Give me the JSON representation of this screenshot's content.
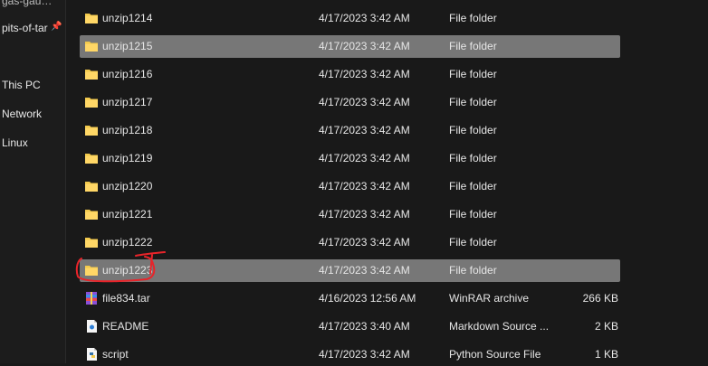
{
  "sidebar": {
    "items": [
      {
        "label": "pits-of-tar"
      },
      {
        "label": "This PC"
      },
      {
        "label": "Network"
      },
      {
        "label": "Linux"
      }
    ]
  },
  "files": [
    {
      "name": "unzip1214",
      "date": "4/17/2023 3:42 AM",
      "type": "File folder",
      "size": "",
      "icon": "folder-icon",
      "selected": false
    },
    {
      "name": "unzip1215",
      "date": "4/17/2023 3:42 AM",
      "type": "File folder",
      "size": "",
      "icon": "folder-icon",
      "selected": true
    },
    {
      "name": "unzip1216",
      "date": "4/17/2023 3:42 AM",
      "type": "File folder",
      "size": "",
      "icon": "folder-icon",
      "selected": false
    },
    {
      "name": "unzip1217",
      "date": "4/17/2023 3:42 AM",
      "type": "File folder",
      "size": "",
      "icon": "folder-icon",
      "selected": false
    },
    {
      "name": "unzip1218",
      "date": "4/17/2023 3:42 AM",
      "type": "File folder",
      "size": "",
      "icon": "folder-icon",
      "selected": false
    },
    {
      "name": "unzip1219",
      "date": "4/17/2023 3:42 AM",
      "type": "File folder",
      "size": "",
      "icon": "folder-icon",
      "selected": false
    },
    {
      "name": "unzip1220",
      "date": "4/17/2023 3:42 AM",
      "type": "File folder",
      "size": "",
      "icon": "folder-icon",
      "selected": false
    },
    {
      "name": "unzip1221",
      "date": "4/17/2023 3:42 AM",
      "type": "File folder",
      "size": "",
      "icon": "folder-icon",
      "selected": false
    },
    {
      "name": "unzip1222",
      "date": "4/17/2023 3:42 AM",
      "type": "File folder",
      "size": "",
      "icon": "folder-icon",
      "selected": false
    },
    {
      "name": "unzip1223",
      "date": "4/17/2023 3:42 AM",
      "type": "File folder",
      "size": "",
      "icon": "folder-icon",
      "selected": true
    },
    {
      "name": "file834.tar",
      "date": "4/16/2023 12:56 AM",
      "type": "WinRAR archive",
      "size": "266 KB",
      "icon": "winrar-archive-icon",
      "selected": false
    },
    {
      "name": "README",
      "date": "4/17/2023 3:40 AM",
      "type": "Markdown Source ...",
      "size": "2 KB",
      "icon": "markdown-file-icon",
      "selected": false
    },
    {
      "name": "script",
      "date": "4/17/2023 3:42 AM",
      "type": "Python Source File",
      "size": "1 KB",
      "icon": "python-file-icon",
      "selected": false
    }
  ],
  "colors": {
    "background": "#191919",
    "selected_row": "#777777",
    "folder": "#f2c94c",
    "annotation": "#e8242a"
  }
}
